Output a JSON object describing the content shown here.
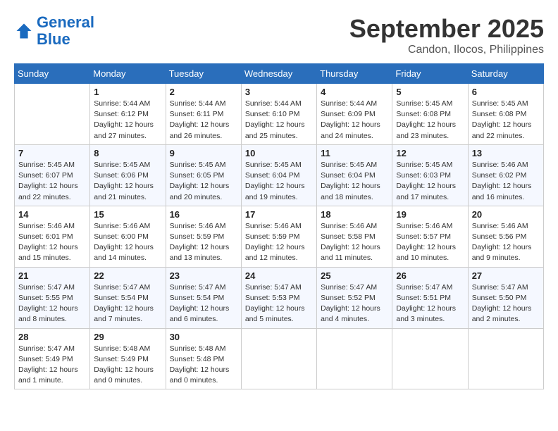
{
  "logo": {
    "line1": "General",
    "line2": "Blue"
  },
  "title": "September 2025",
  "subtitle": "Candon, Ilocos, Philippines",
  "days_of_week": [
    "Sunday",
    "Monday",
    "Tuesday",
    "Wednesday",
    "Thursday",
    "Friday",
    "Saturday"
  ],
  "weeks": [
    [
      {
        "day": "",
        "info": ""
      },
      {
        "day": "1",
        "info": "Sunrise: 5:44 AM\nSunset: 6:12 PM\nDaylight: 12 hours\nand 27 minutes."
      },
      {
        "day": "2",
        "info": "Sunrise: 5:44 AM\nSunset: 6:11 PM\nDaylight: 12 hours\nand 26 minutes."
      },
      {
        "day": "3",
        "info": "Sunrise: 5:44 AM\nSunset: 6:10 PM\nDaylight: 12 hours\nand 25 minutes."
      },
      {
        "day": "4",
        "info": "Sunrise: 5:44 AM\nSunset: 6:09 PM\nDaylight: 12 hours\nand 24 minutes."
      },
      {
        "day": "5",
        "info": "Sunrise: 5:45 AM\nSunset: 6:08 PM\nDaylight: 12 hours\nand 23 minutes."
      },
      {
        "day": "6",
        "info": "Sunrise: 5:45 AM\nSunset: 6:08 PM\nDaylight: 12 hours\nand 22 minutes."
      }
    ],
    [
      {
        "day": "7",
        "info": "Sunrise: 5:45 AM\nSunset: 6:07 PM\nDaylight: 12 hours\nand 22 minutes."
      },
      {
        "day": "8",
        "info": "Sunrise: 5:45 AM\nSunset: 6:06 PM\nDaylight: 12 hours\nand 21 minutes."
      },
      {
        "day": "9",
        "info": "Sunrise: 5:45 AM\nSunset: 6:05 PM\nDaylight: 12 hours\nand 20 minutes."
      },
      {
        "day": "10",
        "info": "Sunrise: 5:45 AM\nSunset: 6:04 PM\nDaylight: 12 hours\nand 19 minutes."
      },
      {
        "day": "11",
        "info": "Sunrise: 5:45 AM\nSunset: 6:04 PM\nDaylight: 12 hours\nand 18 minutes."
      },
      {
        "day": "12",
        "info": "Sunrise: 5:45 AM\nSunset: 6:03 PM\nDaylight: 12 hours\nand 17 minutes."
      },
      {
        "day": "13",
        "info": "Sunrise: 5:46 AM\nSunset: 6:02 PM\nDaylight: 12 hours\nand 16 minutes."
      }
    ],
    [
      {
        "day": "14",
        "info": "Sunrise: 5:46 AM\nSunset: 6:01 PM\nDaylight: 12 hours\nand 15 minutes."
      },
      {
        "day": "15",
        "info": "Sunrise: 5:46 AM\nSunset: 6:00 PM\nDaylight: 12 hours\nand 14 minutes."
      },
      {
        "day": "16",
        "info": "Sunrise: 5:46 AM\nSunset: 5:59 PM\nDaylight: 12 hours\nand 13 minutes."
      },
      {
        "day": "17",
        "info": "Sunrise: 5:46 AM\nSunset: 5:59 PM\nDaylight: 12 hours\nand 12 minutes."
      },
      {
        "day": "18",
        "info": "Sunrise: 5:46 AM\nSunset: 5:58 PM\nDaylight: 12 hours\nand 11 minutes."
      },
      {
        "day": "19",
        "info": "Sunrise: 5:46 AM\nSunset: 5:57 PM\nDaylight: 12 hours\nand 10 minutes."
      },
      {
        "day": "20",
        "info": "Sunrise: 5:46 AM\nSunset: 5:56 PM\nDaylight: 12 hours\nand 9 minutes."
      }
    ],
    [
      {
        "day": "21",
        "info": "Sunrise: 5:47 AM\nSunset: 5:55 PM\nDaylight: 12 hours\nand 8 minutes."
      },
      {
        "day": "22",
        "info": "Sunrise: 5:47 AM\nSunset: 5:54 PM\nDaylight: 12 hours\nand 7 minutes."
      },
      {
        "day": "23",
        "info": "Sunrise: 5:47 AM\nSunset: 5:54 PM\nDaylight: 12 hours\nand 6 minutes."
      },
      {
        "day": "24",
        "info": "Sunrise: 5:47 AM\nSunset: 5:53 PM\nDaylight: 12 hours\nand 5 minutes."
      },
      {
        "day": "25",
        "info": "Sunrise: 5:47 AM\nSunset: 5:52 PM\nDaylight: 12 hours\nand 4 minutes."
      },
      {
        "day": "26",
        "info": "Sunrise: 5:47 AM\nSunset: 5:51 PM\nDaylight: 12 hours\nand 3 minutes."
      },
      {
        "day": "27",
        "info": "Sunrise: 5:47 AM\nSunset: 5:50 PM\nDaylight: 12 hours\nand 2 minutes."
      }
    ],
    [
      {
        "day": "28",
        "info": "Sunrise: 5:47 AM\nSunset: 5:49 PM\nDaylight: 12 hours\nand 1 minute."
      },
      {
        "day": "29",
        "info": "Sunrise: 5:48 AM\nSunset: 5:49 PM\nDaylight: 12 hours\nand 0 minutes."
      },
      {
        "day": "30",
        "info": "Sunrise: 5:48 AM\nSunset: 5:48 PM\nDaylight: 12 hours\nand 0 minutes."
      },
      {
        "day": "",
        "info": ""
      },
      {
        "day": "",
        "info": ""
      },
      {
        "day": "",
        "info": ""
      },
      {
        "day": "",
        "info": ""
      }
    ]
  ]
}
